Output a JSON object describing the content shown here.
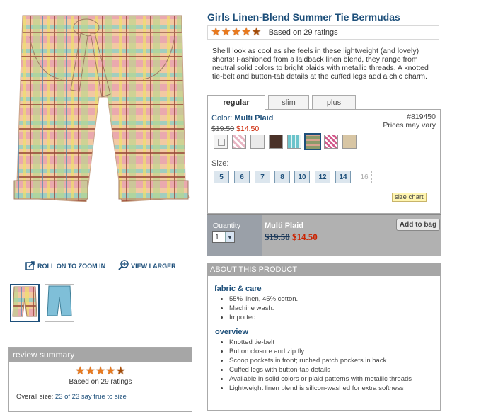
{
  "product": {
    "title": "Girls Linen-Blend Summer Tie Bermudas",
    "rating_text": "Based on 29 ratings",
    "rating_value": 4.5,
    "description": "She'll look as cool as she feels in these lightweight (and lovely) shorts! Fashioned from a laidback linen blend, they range from neutral solid colors to bright plaids with metallic threads. A knotted tie-belt and button-tab details at the cuffed legs add a chic charm."
  },
  "image_tools": {
    "zoom_label": "ROLL ON TO ZOOM IN",
    "larger_label": "VIEW LARGER"
  },
  "tabs": [
    {
      "label": "regular"
    },
    {
      "label": "slim"
    },
    {
      "label": "plus"
    }
  ],
  "color": {
    "label": "Color:",
    "value": "Multi Plaid"
  },
  "item_number": "#819450",
  "price_note": "Prices may vary",
  "price": {
    "original": "$19.50",
    "sale": "$14.50"
  },
  "swatches": [
    {
      "name": "white",
      "color": "#f4f4f4"
    },
    {
      "name": "pink-plaid",
      "color": "#e9b5c3"
    },
    {
      "name": "light-grey",
      "color": "#eaeaea"
    },
    {
      "name": "brown",
      "color": "#4a3128"
    },
    {
      "name": "aqua-plaid",
      "color": "#6cc4cb"
    },
    {
      "name": "multi-plaid",
      "color": "#8a9a6a"
    },
    {
      "name": "pink-check",
      "color": "#d25b8c"
    },
    {
      "name": "khaki",
      "color": "#d8c6a4"
    }
  ],
  "size": {
    "label": "Size:",
    "options": [
      "5",
      "6",
      "7",
      "8",
      "10",
      "12",
      "14",
      "16"
    ],
    "size_chart_label": "size chart"
  },
  "purchase": {
    "quantity_label": "Quantity",
    "quantity_value": "1",
    "item_name": "Multi Plaid",
    "original_price": "$19.50",
    "sale_price": "$14.50",
    "add_to_bag_label": "Add to bag"
  },
  "about": {
    "heading": "ABOUT THIS PRODUCT",
    "fabric_heading": "fabric & care",
    "fabric_items": [
      "55% linen, 45% cotton.",
      "Machine wash.",
      "Imported."
    ],
    "overview_heading": "overview",
    "overview_items": [
      "Knotted tie-belt",
      "Button closure and zip fly",
      "Scoop pockets in front; ruched patch pockets in back",
      "Cuffed legs with button-tab details",
      "Available in solid colors or plaid patterns with metallic threads",
      "Lightweight linen blend is silicon-washed for extra softness"
    ]
  },
  "review_summary": {
    "heading": "review summary",
    "rating_text": "Based on 29 ratings",
    "overall_label": "Overall size:",
    "overall_value": "23 of 23 say true to size"
  },
  "colors": {
    "brand_blue": "#1d4f7a",
    "sale_red": "#cc2200",
    "header_grey": "#a6a6a6",
    "star_orange": "#e8791e"
  }
}
